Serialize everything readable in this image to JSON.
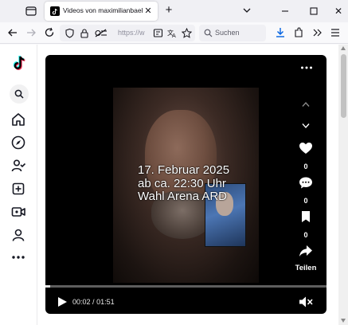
{
  "browser": {
    "tab_title": "Videos von maximilianbaehring",
    "url_placeholder": "https://w",
    "search_placeholder": "Suchen",
    "icons": [
      "tab-overview-icon",
      "tiktok-favicon-icon",
      "close-icon",
      "plus-icon",
      "chevron-down-icon",
      "minimize-icon",
      "maximize-icon",
      "back-icon",
      "forward-icon",
      "reload-icon",
      "shield-icon",
      "lock-icon",
      "permissions-icon",
      "reader-icon",
      "translate-icon",
      "bookmark-star-icon",
      "search-icon",
      "download-icon",
      "extensions-icon",
      "overflow-icon",
      "menu-icon"
    ]
  },
  "sidebar": {
    "items": [
      {
        "name": "tiktok-logo"
      },
      {
        "name": "search"
      },
      {
        "name": "home"
      },
      {
        "name": "explore"
      },
      {
        "name": "following"
      },
      {
        "name": "upload"
      },
      {
        "name": "live"
      },
      {
        "name": "profile"
      },
      {
        "name": "more"
      }
    ]
  },
  "video": {
    "overlay_lines": [
      "17. Februar 2025",
      "ab ca. 22:30 Uhr",
      "Wahl Arena ARD"
    ],
    "time_current": "00:02",
    "time_separator": "/",
    "time_total": "01:51",
    "progress": 0.018
  },
  "actions": {
    "like_count": "0",
    "comment_count": "0",
    "save_count": "0",
    "share_label": "Teilen"
  },
  "colors": {
    "tab_bg": "#f0f0f4",
    "nav_bg": "#f9f9fb",
    "player_bg": "#000000",
    "text": "#15141a"
  }
}
